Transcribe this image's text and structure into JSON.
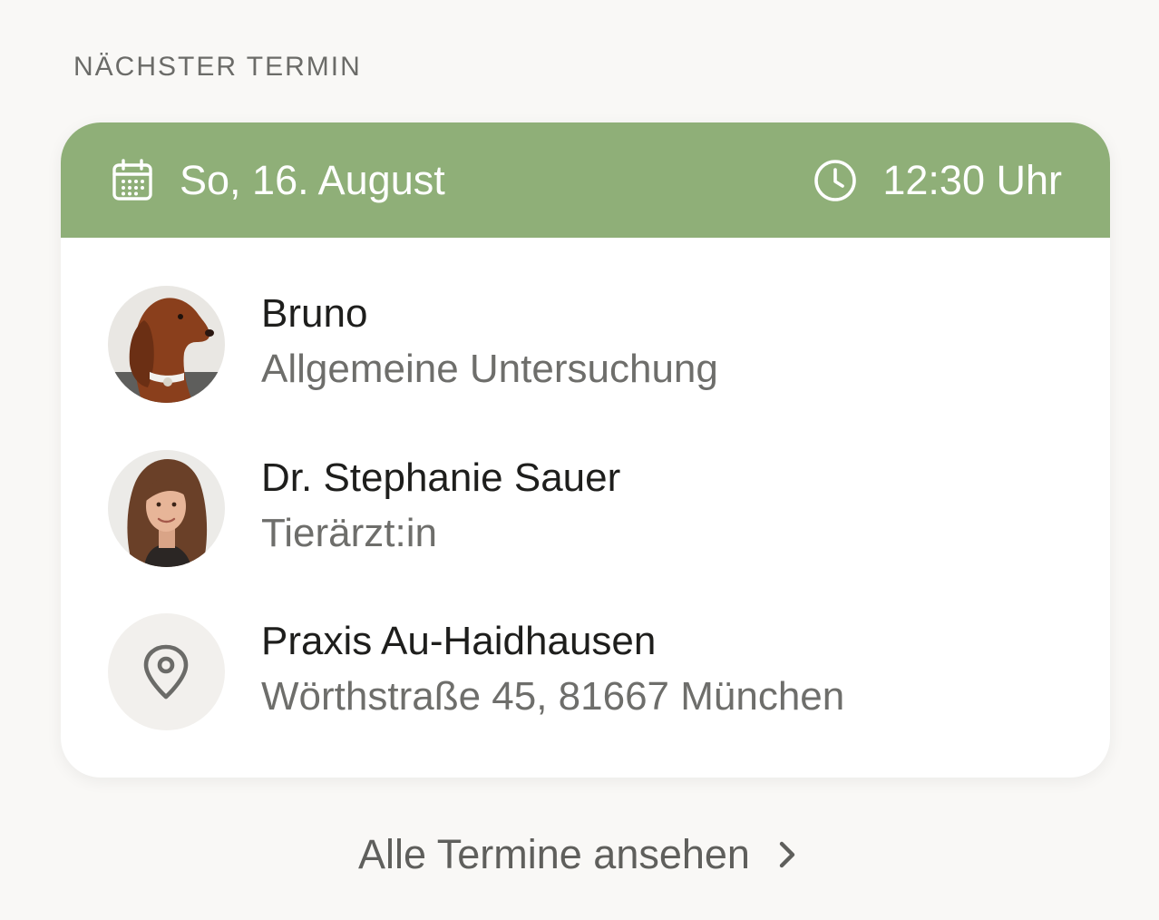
{
  "section": {
    "title": "NÄCHSTER TERMIN"
  },
  "appointment": {
    "date": "So, 16. August",
    "time": "12:30 Uhr",
    "date_icon": "calendar-icon",
    "time_icon": "clock-icon",
    "header_color": "#8faf78",
    "pet": {
      "name": "Bruno",
      "detail": "Allgemeine Untersuchung",
      "avatar": "dog-photo"
    },
    "vet": {
      "name": "Dr. Stephanie Sauer",
      "role": "Tierärzt:in",
      "avatar": "vet-photo"
    },
    "location": {
      "name": "Praxis Au-Haidhausen",
      "address": "Wörthstraße 45, 81667 München",
      "icon": "map-pin-icon"
    }
  },
  "footer": {
    "link_label": "Alle Termine ansehen",
    "link_icon": "chevron-right-icon"
  }
}
